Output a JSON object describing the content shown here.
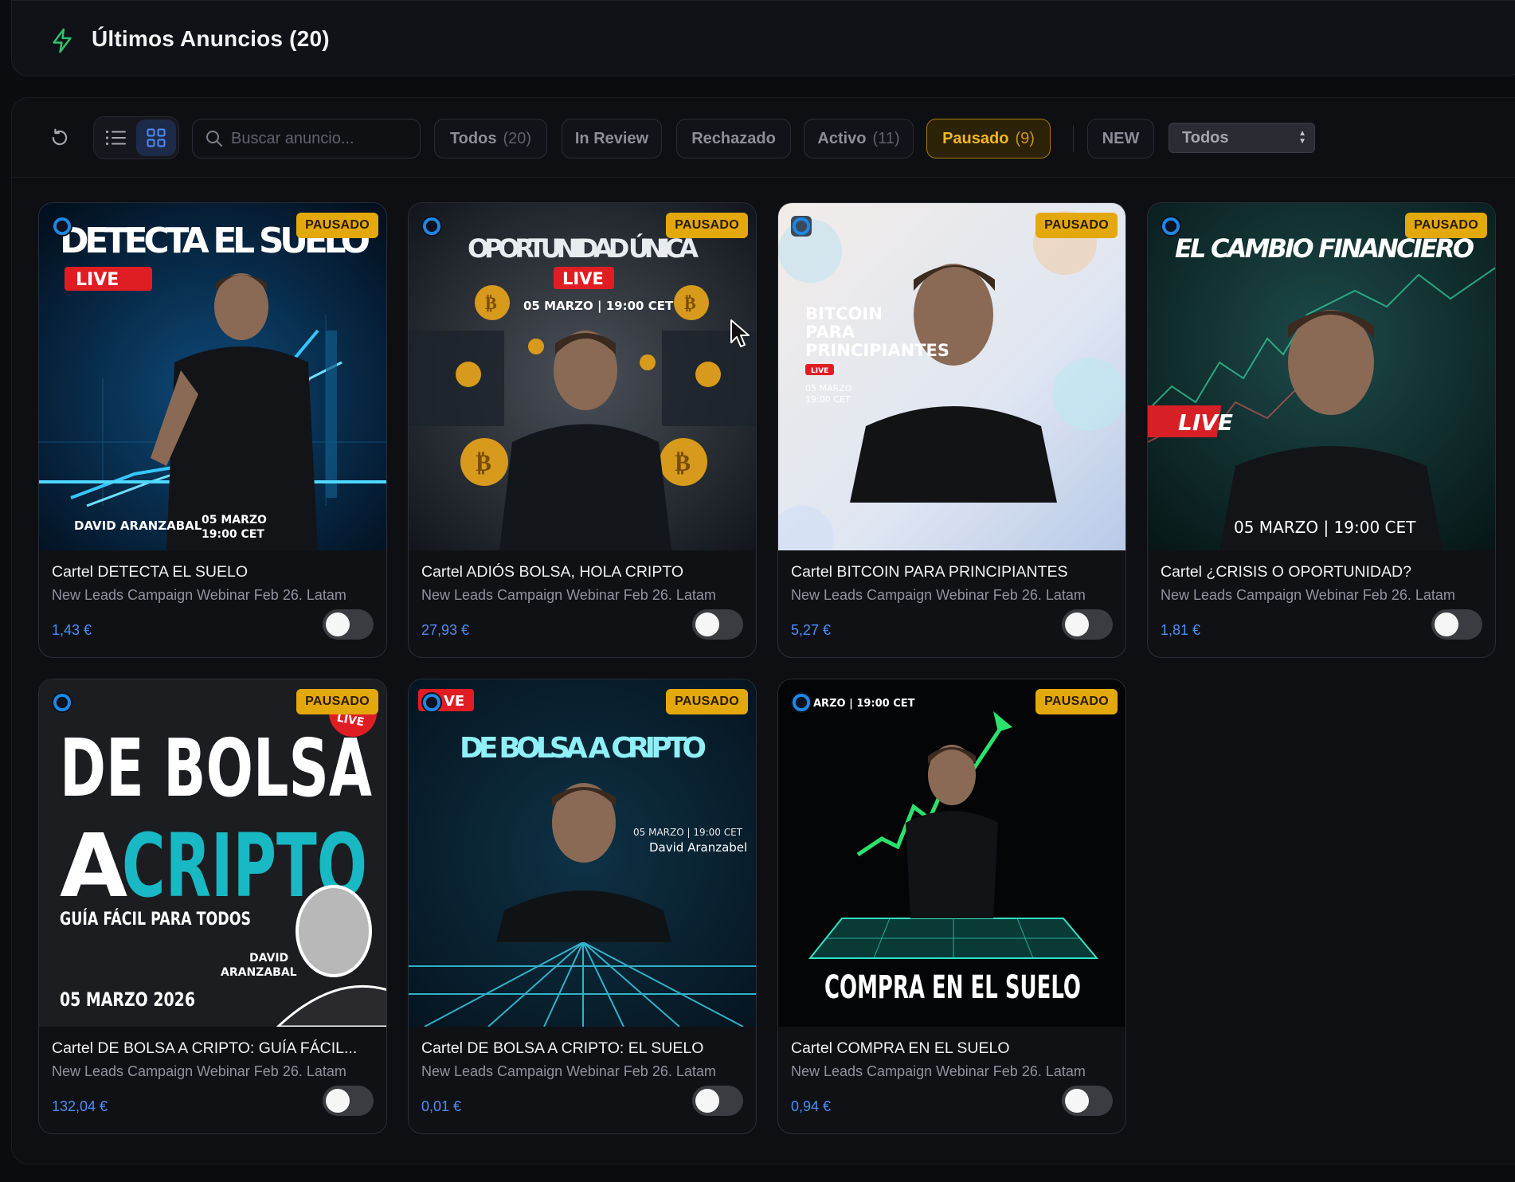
{
  "header": {
    "icon": "lightning-bolt-icon",
    "title": "Últimos Anuncios (20)"
  },
  "toolbar": {
    "search_placeholder": "Buscar anuncio...",
    "filters": [
      {
        "label": "Todos",
        "count": "(20)"
      },
      {
        "label": "In Review",
        "count": ""
      },
      {
        "label": "Rechazado",
        "count": ""
      },
      {
        "label": "Activo",
        "count": "(11)"
      },
      {
        "label": "Pausado",
        "count": "(9)"
      }
    ],
    "new_label": "NEW",
    "select_value": "Todos",
    "active_color": "#f4b71d"
  },
  "cards": [
    {
      "title": "Cartel DETECTA EL SUELO",
      "campaign": "New Leads Campaign Webinar Feb 26. Latam",
      "price": "1,43 €",
      "status": "PAUSADO",
      "enabled": false,
      "image": {
        "headline": "DETECTA EL SUELO",
        "live": "LIVE",
        "name": "DAVID ARANZABAL",
        "date": "05 MARZO",
        "time": "19:00 CET"
      }
    },
    {
      "title": "Cartel ADIÓS BOLSA, HOLA CRIPTO",
      "campaign": "New Leads Campaign Webinar Feb 26. Latam",
      "price": "27,93 €",
      "status": "PAUSADO",
      "enabled": false,
      "image": {
        "headline": "OPORTUNIDAD ÚNICA",
        "live": "LIVE",
        "date": "05 MARZO | 19:00 CET"
      }
    },
    {
      "title": "Cartel BITCOIN PARA PRINCIPIANTES",
      "campaign": "New Leads Campaign Webinar Feb 26. Latam",
      "price": "5,27 €",
      "status": "PAUSADO",
      "enabled": false,
      "image": {
        "line1": "BITCOIN",
        "line2": "PARA",
        "line3": "PRINCIPIANTES",
        "live": "LIVE",
        "date": "05 MARZO",
        "time": "19:00 CET"
      }
    },
    {
      "title": "Cartel ¿CRISIS O OPORTUNIDAD?",
      "campaign": "New Leads Campaign Webinar Feb 26. Latam",
      "price": "1,81 €",
      "status": "PAUSADO",
      "enabled": false,
      "image": {
        "headline": "EL CAMBIO FINANCIERO",
        "live": "LIVE",
        "date": "05 MARZO | 19:00 CET"
      }
    },
    {
      "title": "Cartel DE BOLSA A CRIPTO: GUÍA FÁCIL...",
      "campaign": "New Leads Campaign Webinar Feb 26. Latam",
      "price": "132,04 €",
      "status": "PAUSADO",
      "enabled": false,
      "image": {
        "line1": "DE BOLSA",
        "line2a": "A",
        "line2b": "CRIPTO",
        "sub": "GUÍA FÁCIL PARA TODOS",
        "name1": "DAVID",
        "name2": "ARANZABAL",
        "date": "05 MARZO 2026",
        "live": "LIVE"
      }
    },
    {
      "title": "Cartel DE BOLSA A CRIPTO: EL SUELO",
      "campaign": "New Leads Campaign Webinar Feb 26. Latam",
      "price": "0,01 €",
      "status": "PAUSADO",
      "enabled": false,
      "image": {
        "headline": "DE BOLSA A CRIPTO",
        "live": "VE",
        "date": "05 MARZO | 19:00 CET",
        "name": "David Aranzabel"
      }
    },
    {
      "title": "Cartel COMPRA EN EL SUELO",
      "campaign": "New Leads Campaign Webinar Feb 26. Latam",
      "price": "0,94 €",
      "status": "PAUSADO",
      "enabled": false,
      "image": {
        "headline": "COMPRA EN EL SUELO",
        "date": "ARZO | 19:00 CET"
      }
    }
  ]
}
